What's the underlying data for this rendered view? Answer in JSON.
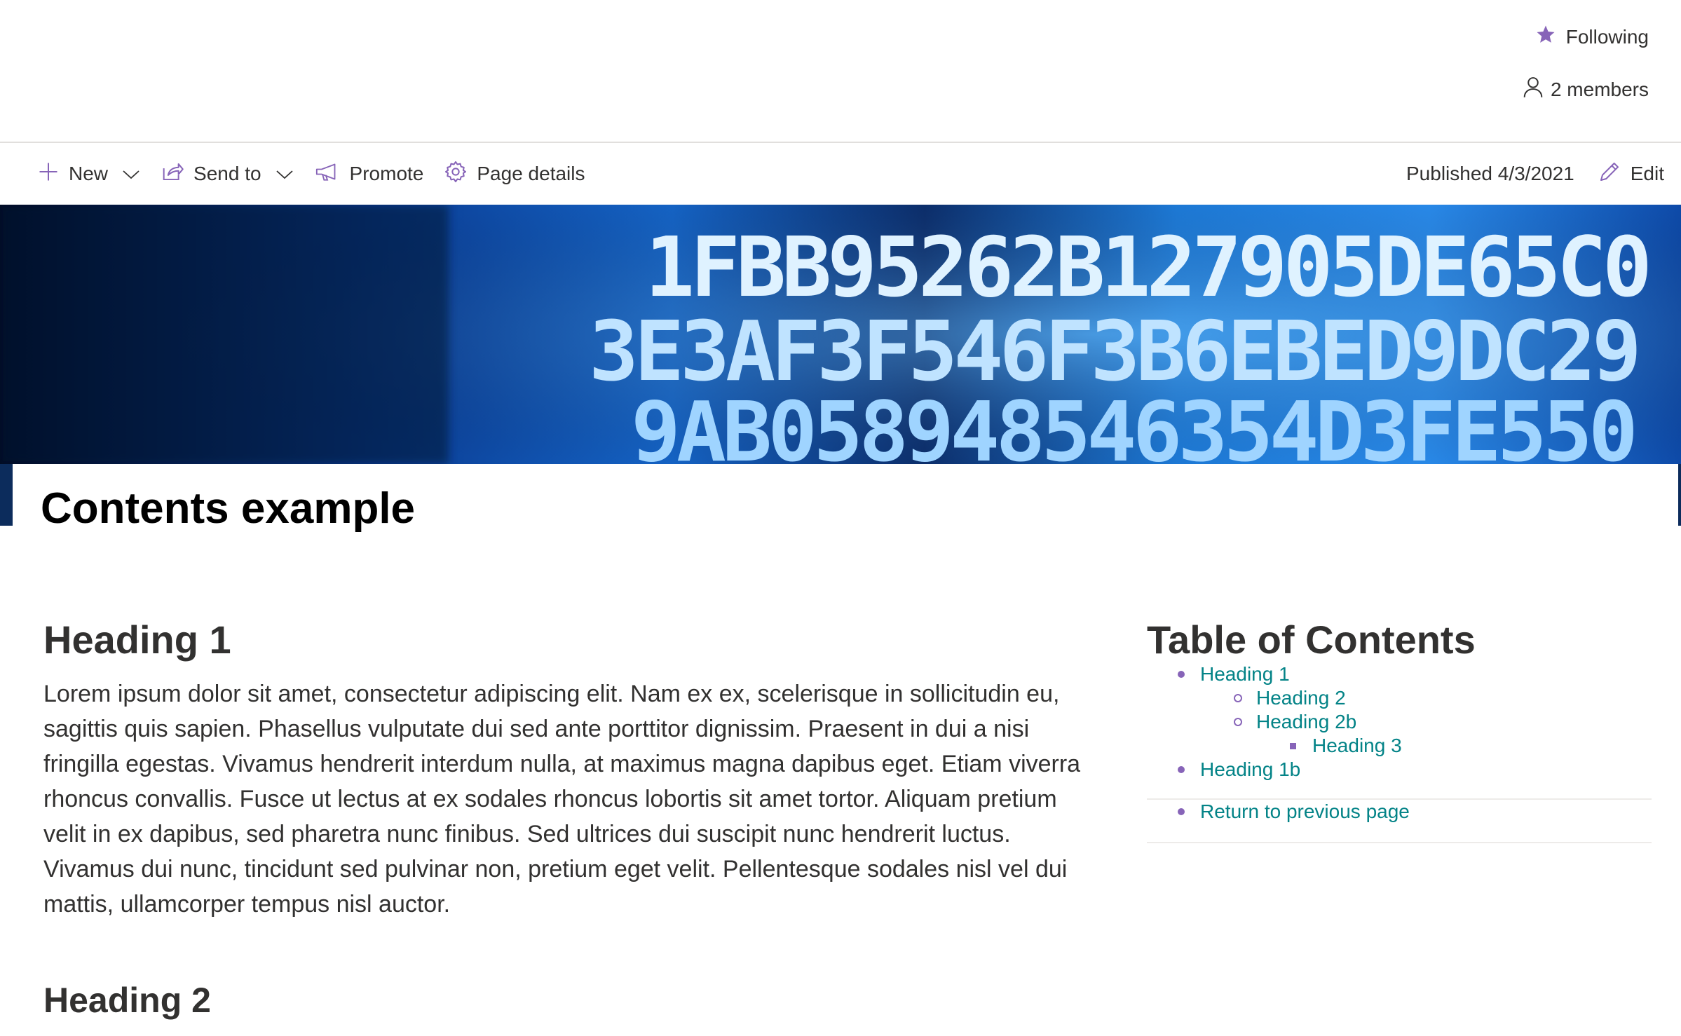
{
  "header": {
    "follow_label": "Following",
    "members_label": "2 members"
  },
  "commands": {
    "new": "New",
    "send_to": "Send to",
    "promote": "Promote",
    "page_details": "Page details",
    "published": "Published 4/3/2021",
    "edit": "Edit"
  },
  "banner": {
    "rows": [
      "1FBB95262B127905DE65C0",
      "3E3AF3F546F3B6EBED9DC29",
      "9AB058948546354D3FE550"
    ]
  },
  "page": {
    "title": "Contents example"
  },
  "content": {
    "heading1": "Heading 1",
    "paragraph": "Lorem ipsum dolor sit amet, consectetur adipiscing elit. Nam ex ex, scelerisque in sollicitudin eu, sagittis quis sapien. Phasellus vulputate dui sed ante porttitor dignissim. Praesent in dui a nisi fringilla egestas. Vivamus hendrerit interdum nulla, at maximus magna dapibus eget. Etiam viverra rhoncus convallis. Fusce ut lectus at ex sodales rhoncus lobortis sit amet tortor. Aliquam pretium velit in ex dapibus, sed pharetra nunc finibus. Sed ultrices dui suscipit nunc hendrerit luctus. Vivamus dui nunc, tincidunt sed pulvinar non, pretium eget velit. Pellentesque sodales nisl vel dui mattis, ullamcorper tempus nisl auctor.",
    "heading2": "Heading 2"
  },
  "toc": {
    "title": "Table of Contents",
    "items": [
      {
        "label": "Heading 1"
      },
      {
        "label": "Heading 2"
      },
      {
        "label": "Heading 2b"
      },
      {
        "label": "Heading 3"
      },
      {
        "label": "Heading 1b"
      }
    ],
    "return_label": "Return to previous page"
  },
  "colors": {
    "accent": "#8764b8",
    "link": "#038387",
    "text": "#323130"
  }
}
